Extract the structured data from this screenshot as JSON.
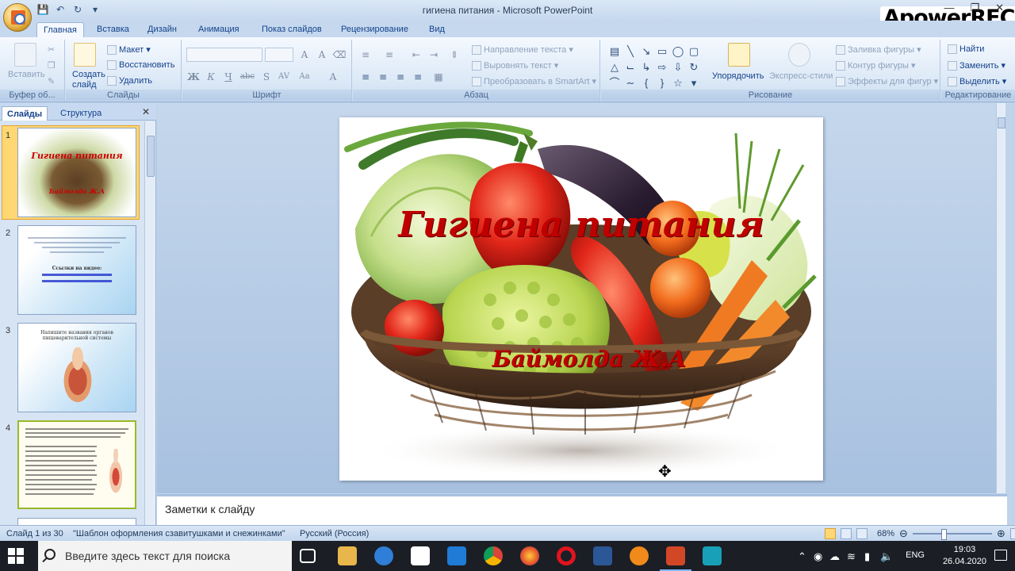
{
  "window": {
    "title": "гигиена питания - Microsoft PowerPoint",
    "recorder_watermark": "ApowerREC"
  },
  "ribbon_tabs": [
    "Главная",
    "Вставка",
    "Дизайн",
    "Анимация",
    "Показ слайдов",
    "Рецензирование",
    "Вид"
  ],
  "ribbon": {
    "clipboard": {
      "label": "Буфер об...",
      "paste": "Вставить"
    },
    "slides": {
      "label": "Слайды",
      "new_slide_line1": "Создать",
      "new_slide_line2": "слайд",
      "layout": "Макет",
      "reset": "Восстановить",
      "delete": "Удалить"
    },
    "font": {
      "label": "Шрифт"
    },
    "paragraph": {
      "label": "Абзац",
      "text_direction": "Направление текста",
      "align_text": "Выровнять текст",
      "smartart": "Преобразовать в SmartArt"
    },
    "drawing": {
      "label": "Рисование",
      "arrange": "Упорядочить",
      "quick_styles": "Экспресс-стили",
      "shape_fill": "Заливка фигуры",
      "shape_outline": "Контур фигуры",
      "shape_effects": "Эффекты для фигур"
    },
    "editing": {
      "label": "Редактирование",
      "find": "Найти",
      "replace": "Заменить",
      "select": "Выделить"
    }
  },
  "left_pane": {
    "tabs": [
      "Слайды",
      "Структура"
    ],
    "thumbnails": [
      {
        "number": "1",
        "title": "Гигиена питания",
        "subtitle": "Баймолда Ж.А"
      },
      {
        "number": "2",
        "heading": "Ссылки на видео:"
      },
      {
        "number": "3",
        "heading": "Напишите названия органов пищеварительной системы"
      },
      {
        "number": "4"
      }
    ]
  },
  "slide": {
    "title": "Гигиена питания",
    "subtitle": "Баймолда Ж.А"
  },
  "notes_placeholder": "Заметки к слайду",
  "status_bar": {
    "slide_info": "Слайд 1 из 30",
    "theme": "\"Шаблон оформления сзавитушками и снежинками\"",
    "language": "Русский (Россия)",
    "zoom": "68%"
  },
  "taskbar": {
    "search_placeholder": "Введите здесь текст для поиска",
    "language": "ENG",
    "time": "19:03",
    "date": "26.04.2020"
  }
}
